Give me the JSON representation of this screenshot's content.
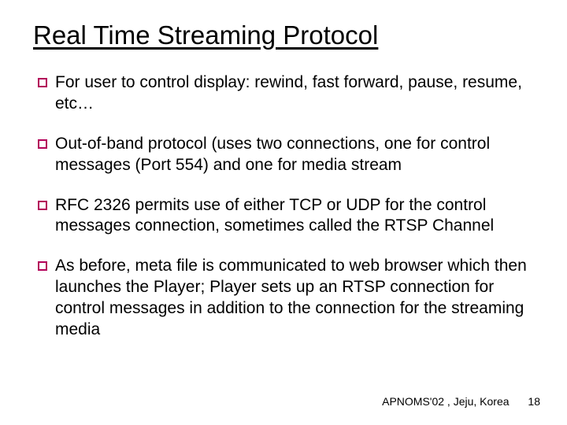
{
  "title": "Real Time Streaming Protocol",
  "bullets": [
    "For user to control display: rewind, fast forward, pause, resume, etc…",
    "Out-of-band protocol (uses two connections, one for control messages (Port 554) and one for media stream",
    "RFC 2326 permits use of either TCP or UDP for the control messages connection, sometimes called the RTSP Channel",
    "As before, meta file is communicated to web browser which then launches the Player; Player sets up an RTSP connection for control messages in addition to the connection for the streaming media"
  ],
  "footer": {
    "venue": "APNOMS'02 , Jeju, Korea",
    "page": "18"
  }
}
